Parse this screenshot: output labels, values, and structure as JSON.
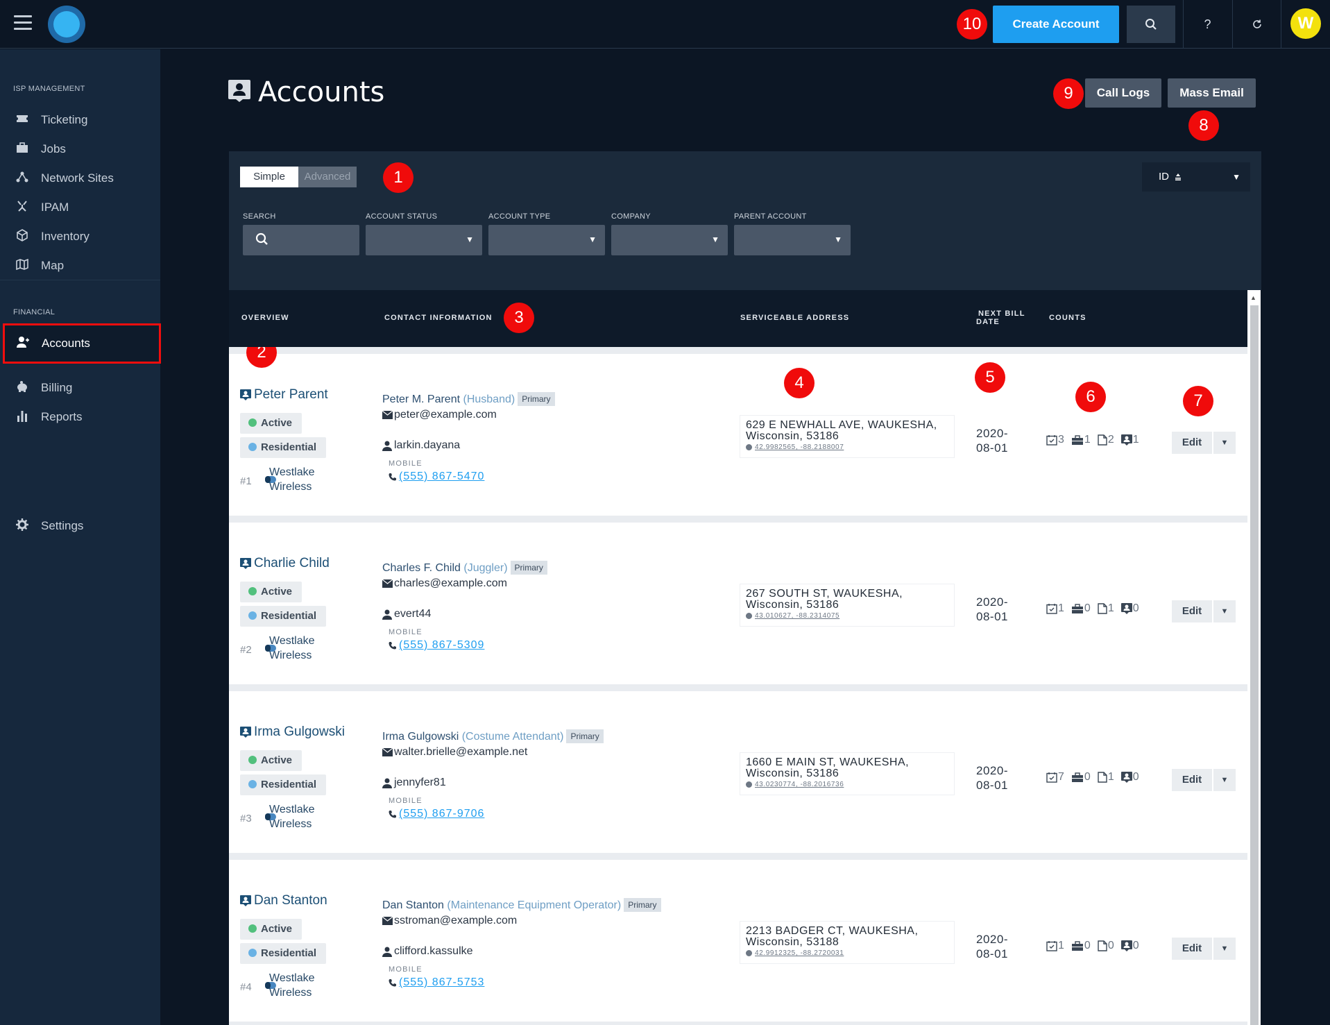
{
  "header": {
    "create_account": "Create Account",
    "help_icon": "?",
    "avatar_initial": "W"
  },
  "markers": [
    "1",
    "2",
    "3",
    "4",
    "5",
    "6",
    "7",
    "8",
    "9",
    "10"
  ],
  "sidebar": {
    "section_isp": "ISP MANAGEMENT",
    "section_financial": "FINANCIAL",
    "items": [
      {
        "label": "Ticketing",
        "icon": "ticket-icon"
      },
      {
        "label": "Jobs",
        "icon": "briefcase-icon"
      },
      {
        "label": "Network Sites",
        "icon": "network-icon"
      },
      {
        "label": "IPAM",
        "icon": "ipam-icon"
      },
      {
        "label": "Inventory",
        "icon": "box-icon"
      },
      {
        "label": "Map",
        "icon": "map-icon"
      },
      {
        "label": "Accounts",
        "icon": "accounts-icon",
        "active": true
      },
      {
        "label": "Billing",
        "icon": "piggy-bank-icon"
      },
      {
        "label": "Reports",
        "icon": "bar-chart-icon"
      },
      {
        "label": "Settings",
        "icon": "gear-icon"
      }
    ]
  },
  "page": {
    "title": "Accounts",
    "call_logs": "Call Logs",
    "mass_email": "Mass Email"
  },
  "filters": {
    "mode_simple": "Simple",
    "mode_advanced": "Advanced",
    "sort_value": "ID",
    "search_label": "SEARCH",
    "status_label": "ACCOUNT STATUS",
    "type_label": "ACCOUNT TYPE",
    "company_label": "COMPANY",
    "parent_label": "PARENT ACCOUNT"
  },
  "table": {
    "headers": {
      "overview": "OVERVIEW",
      "contact": "CONTACT INFORMATION",
      "address": "SERVICEABLE ADDRESS",
      "bill_line1": "NEXT BILL",
      "bill_line2": "DATE",
      "counts": "COUNTS"
    },
    "mobile_label": "MOBILE",
    "edit_label": "Edit",
    "rows": [
      {
        "name": "Peter Parent",
        "status": "Active",
        "type": "Residential",
        "id": "#1",
        "company_line1": "Westlake",
        "company_line2": "Wireless",
        "contact_name": "Peter M. Parent",
        "contact_role": "(Husband)",
        "primary": "Primary",
        "email": "peter@example.com",
        "username": "larkin.dayana",
        "phone": "(555) 867-5470",
        "address_line1": "629 E NEWHALL AVE, WAUKESHA,",
        "address_line2": "Wisconsin, 53186",
        "coords": "42.9982565, -88.2188007",
        "bill_line1": "2020-",
        "bill_line2": "08-01",
        "counts": {
          "tasks": "3",
          "jobs": "1",
          "docs": "2",
          "tickets": "1"
        }
      },
      {
        "name": "Charlie Child",
        "status": "Active",
        "type": "Residential",
        "id": "#2",
        "company_line1": "Westlake",
        "company_line2": "Wireless",
        "contact_name": "Charles F. Child",
        "contact_role": "(Juggler)",
        "primary": "Primary",
        "email": "charles@example.com",
        "username": "evert44",
        "phone": "(555) 867-5309",
        "address_line1": "267 SOUTH ST, WAUKESHA,",
        "address_line2": "Wisconsin, 53186",
        "coords": "43.010627, -88.2314075",
        "bill_line1": "2020-",
        "bill_line2": "08-01",
        "counts": {
          "tasks": "1",
          "jobs": "0",
          "docs": "1",
          "tickets": "0"
        }
      },
      {
        "name": "Irma Gulgowski",
        "status": "Active",
        "type": "Residential",
        "id": "#3",
        "company_line1": "Westlake",
        "company_line2": "Wireless",
        "contact_name": "Irma Gulgowski",
        "contact_role": "(Costume Attendant)",
        "primary": "Primary",
        "email": "walter.brielle@example.net",
        "username": "jennyfer81",
        "phone": "(555) 867-9706",
        "address_line1": "1660 E MAIN ST, WAUKESHA,",
        "address_line2": "Wisconsin, 53186",
        "coords": "43.0230774, -88.2016736",
        "bill_line1": "2020-",
        "bill_line2": "08-01",
        "counts": {
          "tasks": "7",
          "jobs": "0",
          "docs": "1",
          "tickets": "0"
        }
      },
      {
        "name": "Dan Stanton",
        "status": "Active",
        "type": "Residential",
        "id": "#4",
        "company_line1": "Westlake",
        "company_line2": "Wireless",
        "contact_name": "Dan Stanton",
        "contact_role": "(Maintenance Equipment Operator)",
        "primary": "Primary",
        "email": "sstroman@example.com",
        "username": "clifford.kassulke",
        "phone": "(555) 867-5753",
        "address_line1": "2213 BADGER CT, WAUKESHA,",
        "address_line2": "Wisconsin, 53188",
        "coords": "42.9912325, -88.2720031",
        "bill_line1": "2020-",
        "bill_line2": "08-01",
        "counts": {
          "tasks": "1",
          "jobs": "0",
          "docs": "0",
          "tickets": "0"
        }
      }
    ]
  }
}
